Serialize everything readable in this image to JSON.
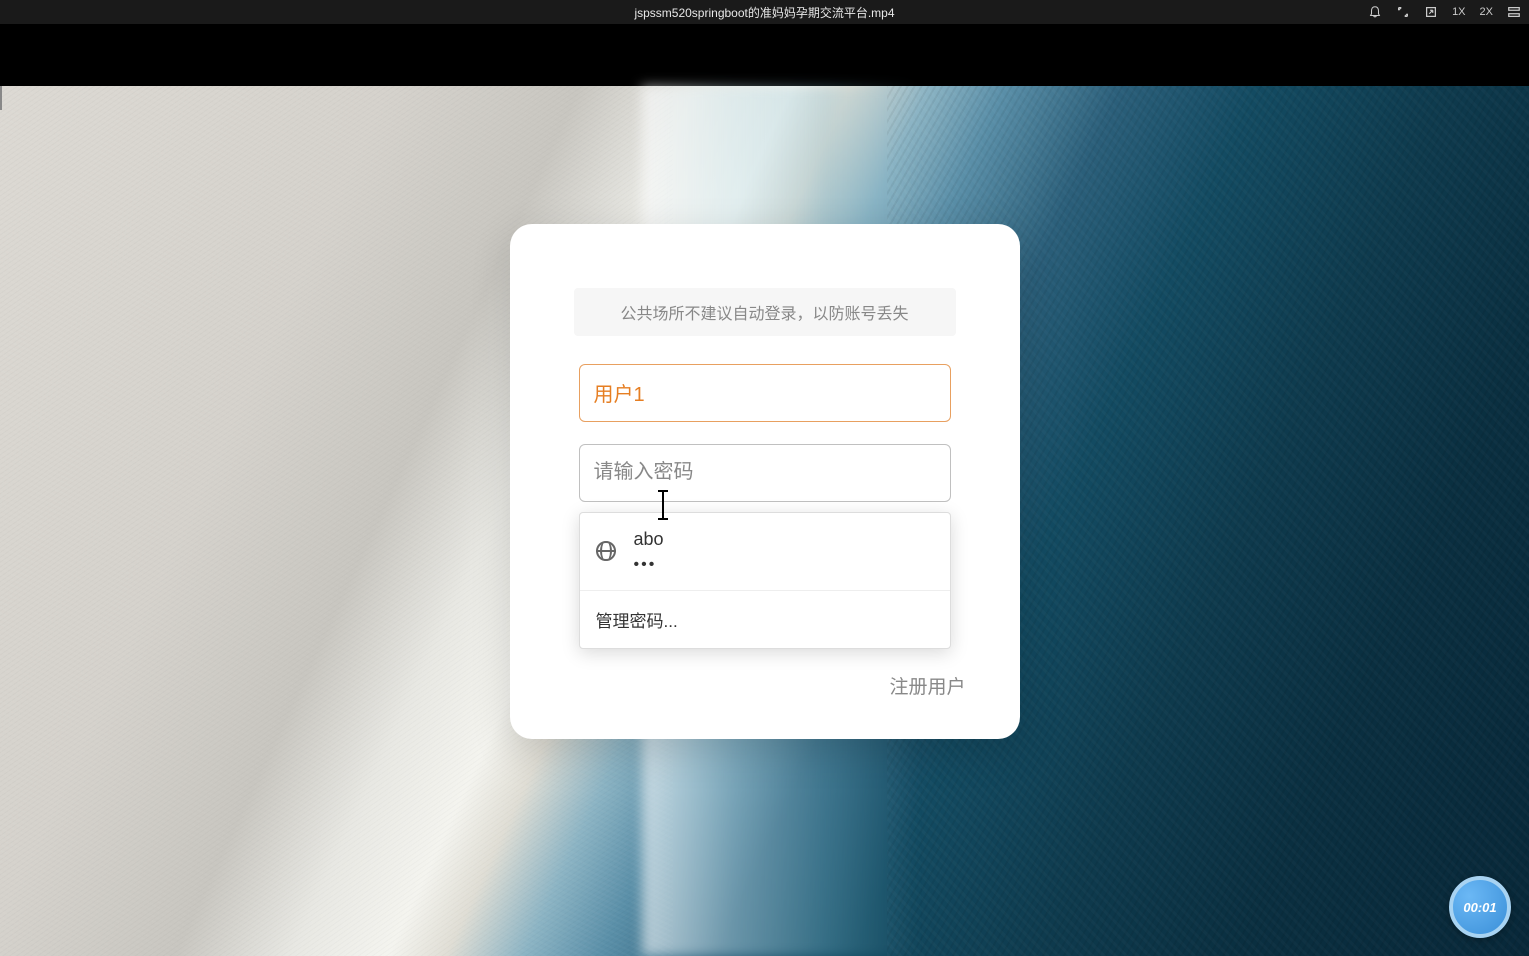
{
  "titlebar": {
    "filename": "jspssm520springboot的准妈妈孕期交流平台.mp4",
    "speed_1x": "1X",
    "speed_2x": "2X"
  },
  "login": {
    "hint_text": "公共场所不建议自动登录，以防账号丢失",
    "username_value": "用户1",
    "password_placeholder": "请输入密码",
    "register_label": "注册用户"
  },
  "autocomplete": {
    "saved_user": "abo",
    "saved_pass_masked": "•••",
    "manage_label": "管理密码..."
  },
  "timer": {
    "display": "00:01"
  }
}
